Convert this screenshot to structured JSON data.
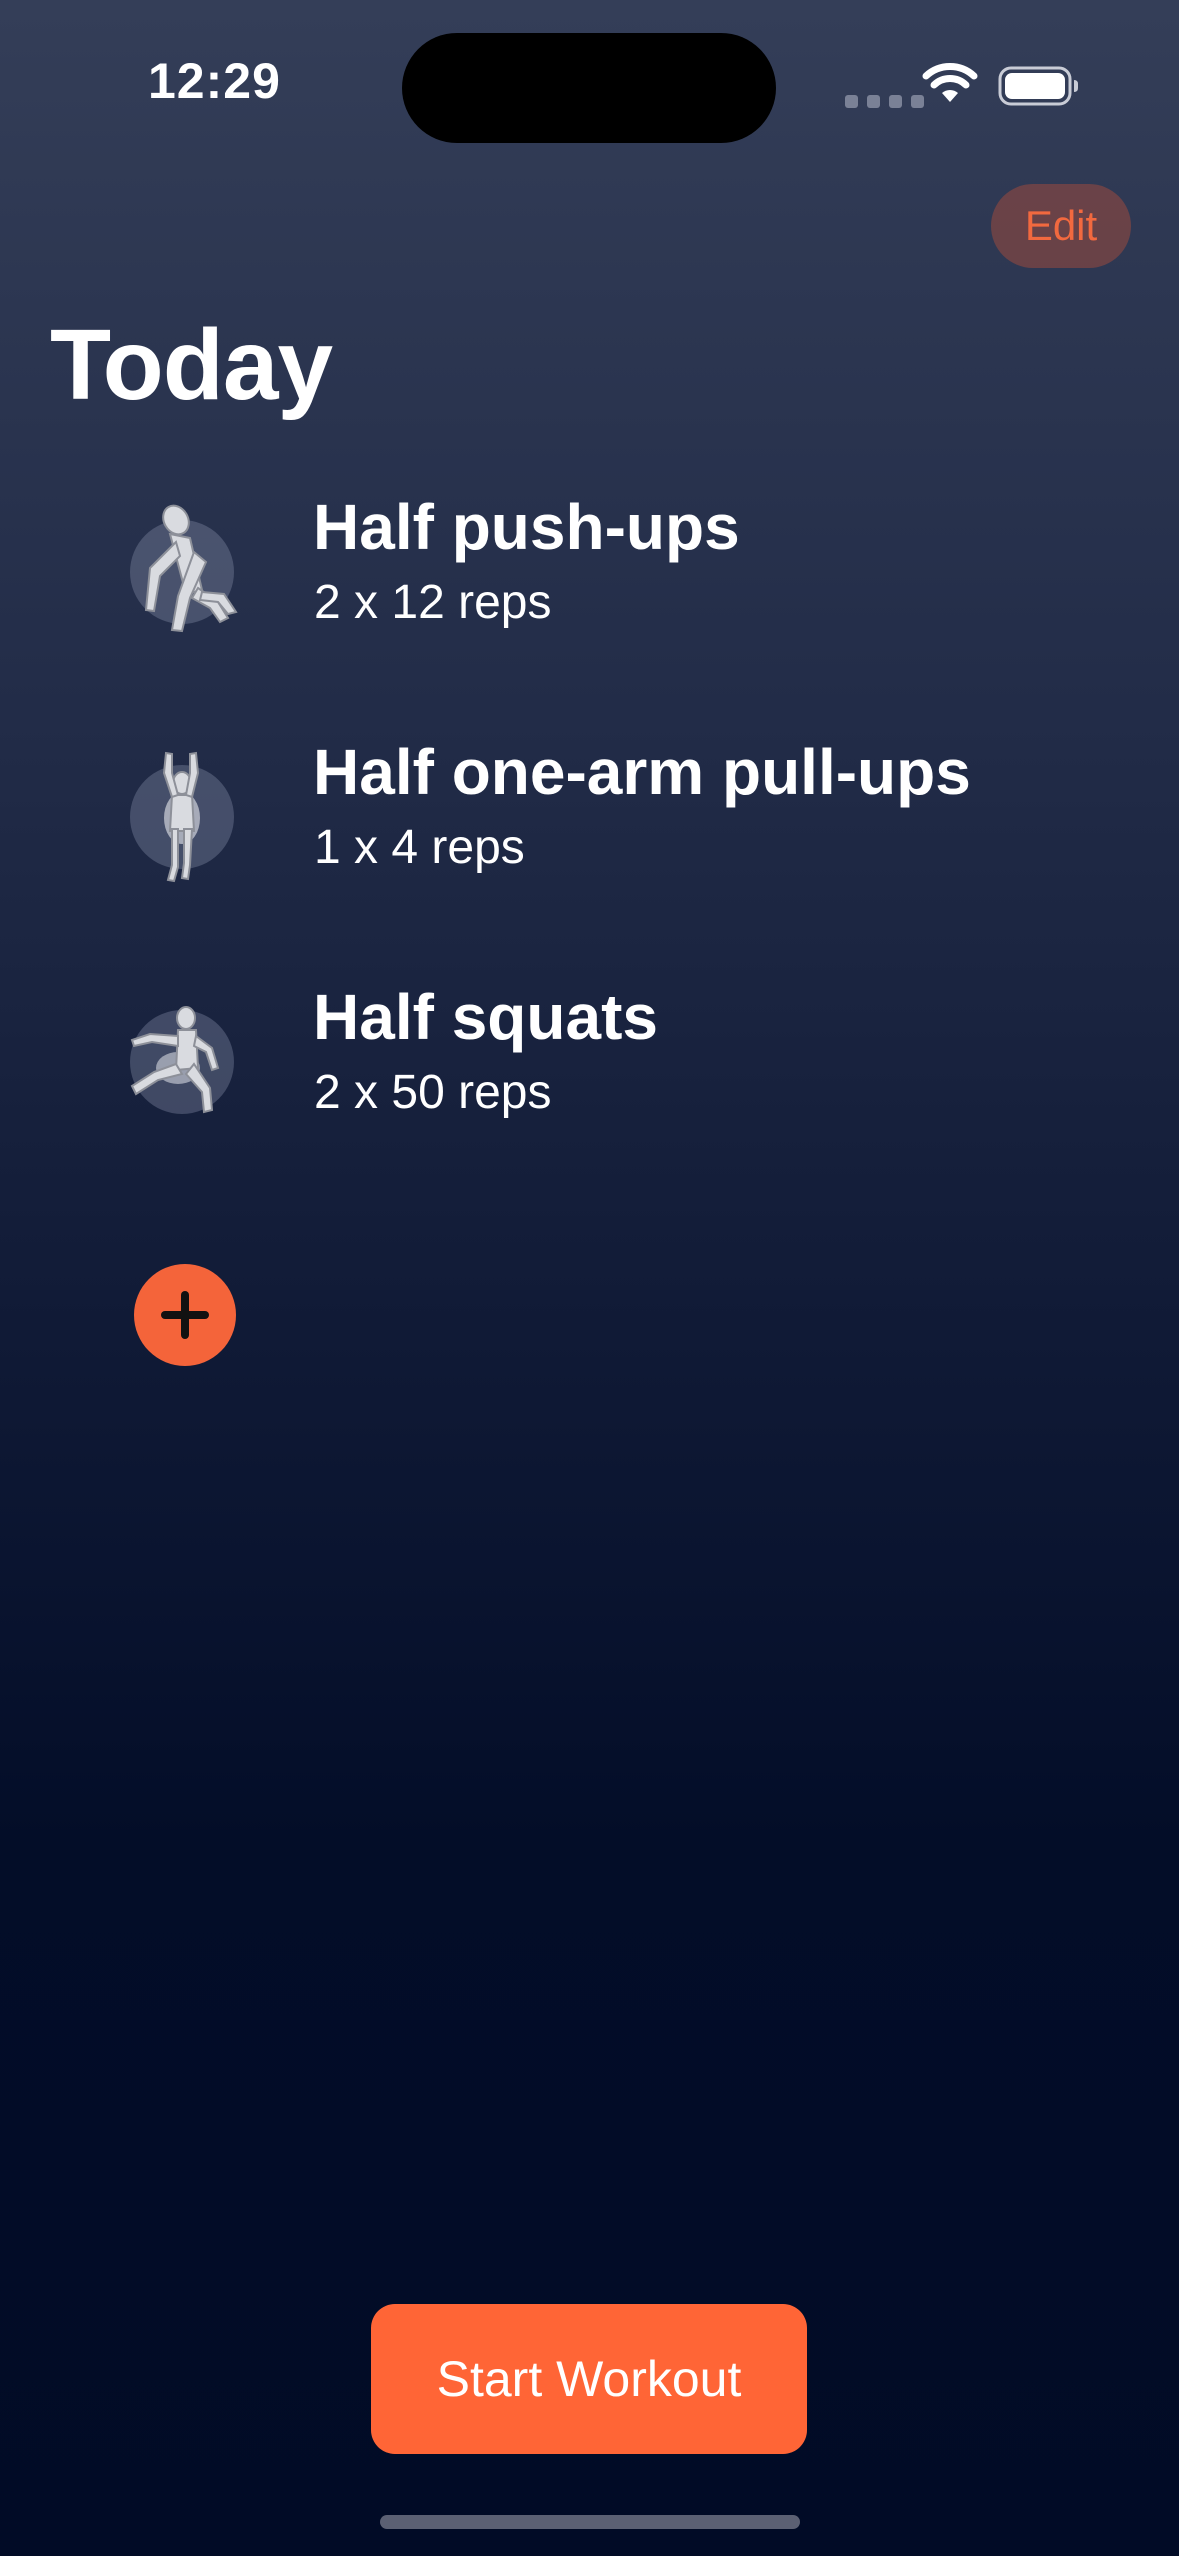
{
  "status_bar": {
    "time": "12:29"
  },
  "header": {
    "edit_label": "Edit",
    "title": "Today"
  },
  "exercises": [
    {
      "name": "Half push-ups",
      "detail": "2 x 12 reps",
      "icon": "push-up-figure-icon"
    },
    {
      "name": "Half one-arm pull-ups",
      "detail": "1 x 4 reps",
      "icon": "pull-up-figure-icon"
    },
    {
      "name": "Half squats",
      "detail": "2 x 50 reps",
      "icon": "squat-figure-icon"
    }
  ],
  "add_button": {
    "icon": "plus-icon"
  },
  "footer": {
    "start_label": "Start Workout"
  },
  "colors": {
    "accent": "#ff6536",
    "edit_text": "#f2693f",
    "background_top": "#343e58",
    "background_bottom": "#010b26"
  }
}
